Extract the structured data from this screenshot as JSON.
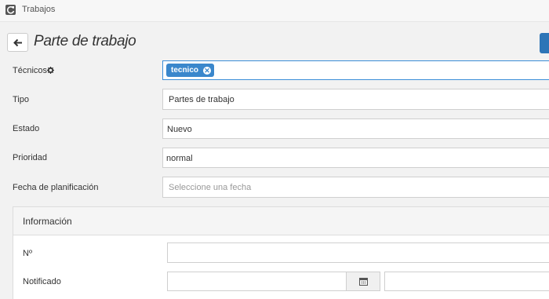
{
  "topbar": {
    "title": "Trabajos",
    "icon": "refresh-icon"
  },
  "header": {
    "title": "Parte de trabajo",
    "back_icon": "arrow-left-icon"
  },
  "form": {
    "tecnicos": {
      "label": "Técnicos",
      "tags": [
        "tecnico"
      ]
    },
    "tipo": {
      "label": "Tipo",
      "value": "Partes de trabajo"
    },
    "estado": {
      "label": "Estado",
      "value": "Nuevo"
    },
    "prioridad": {
      "label": "Prioridad",
      "value": "normal"
    },
    "fecha": {
      "label": "Fecha de planificación",
      "placeholder": "Seleccione una fecha"
    }
  },
  "informacion": {
    "title": "Información",
    "numero_label": "Nº",
    "notificado_label": "Notificado"
  },
  "colors": {
    "accent": "#2d75b7",
    "tag": "#3a87cc"
  }
}
